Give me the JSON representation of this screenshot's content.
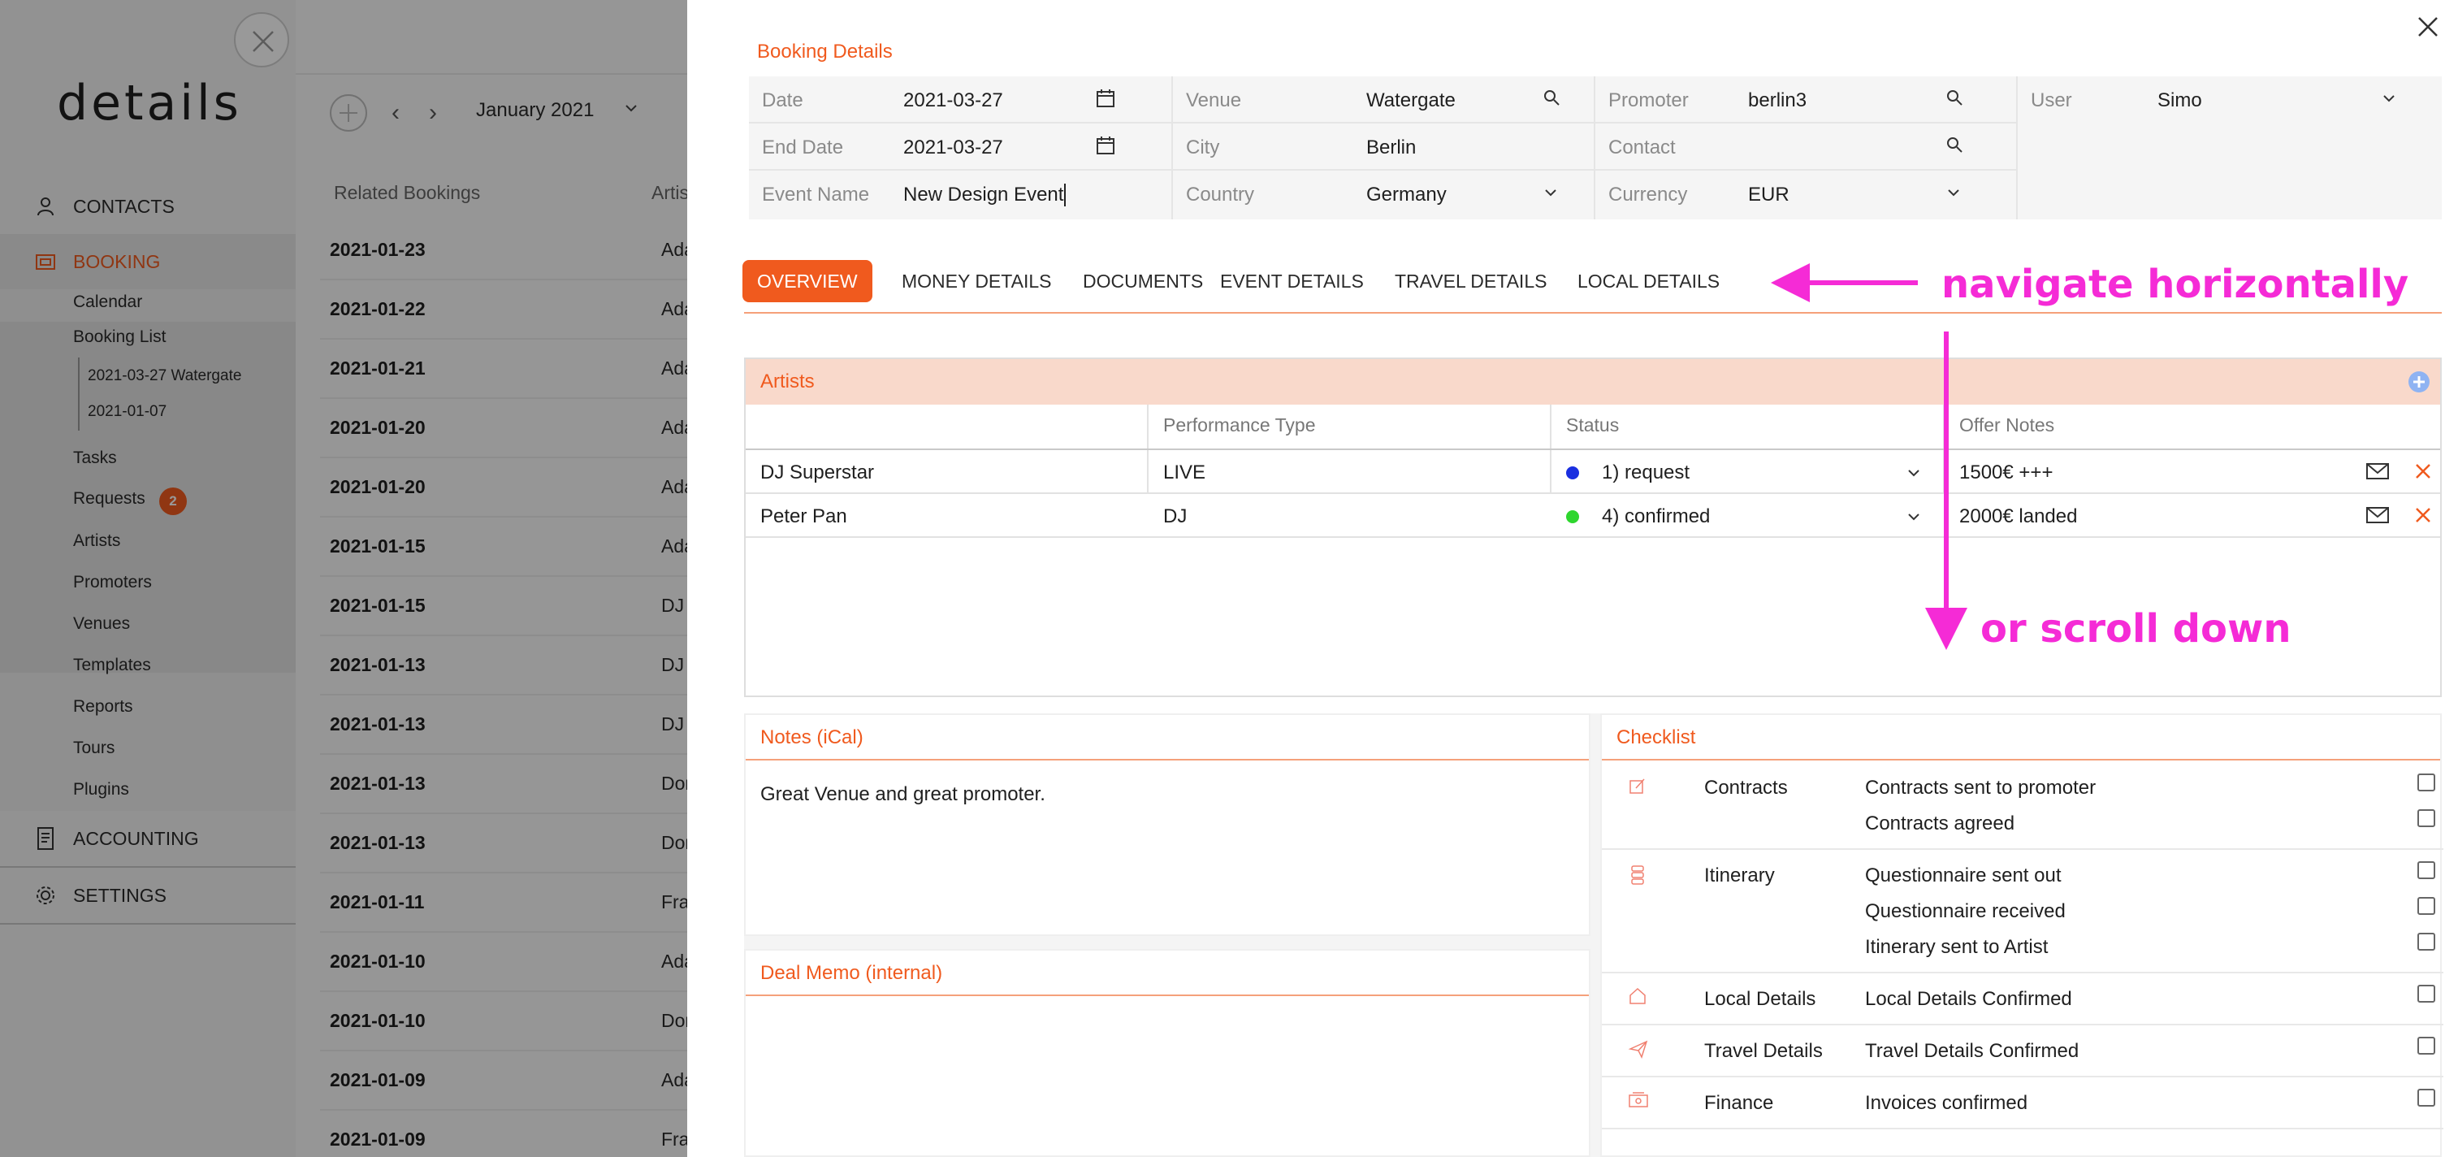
{
  "sidebar": {
    "logo": "details",
    "nav": {
      "contacts": "CONTACTS",
      "booking": "BOOKING",
      "accounting": "ACCOUNTING",
      "settings": "SETTINGS"
    },
    "booking_items": {
      "calendar": "Calendar",
      "booking_list": "Booking List",
      "sub1": "2021-03-27 Watergate",
      "sub2": "2021-01-07",
      "tasks": "Tasks",
      "requests": "Requests",
      "requests_badge": "2",
      "artists": "Artists",
      "promoters": "Promoters",
      "venues": "Venues",
      "templates": "Templates",
      "reports": "Reports",
      "tours": "Tours",
      "plugins": "Plugins"
    },
    "accent_color": "#f05a1e"
  },
  "list": {
    "month": "January 2021",
    "col_related": "Related Bookings",
    "col_artist": "Artist",
    "rows": [
      {
        "date": "2021-01-23",
        "artist": "Adam"
      },
      {
        "date": "2021-01-22",
        "artist": "Adam"
      },
      {
        "date": "2021-01-21",
        "artist": "Adam"
      },
      {
        "date": "2021-01-20",
        "artist": "Adam"
      },
      {
        "date": "2021-01-20",
        "artist": "Adam"
      },
      {
        "date": "2021-01-15",
        "artist": "Adam"
      },
      {
        "date": "2021-01-15",
        "artist": "DJ S"
      },
      {
        "date": "2021-01-13",
        "artist": "DJ S"
      },
      {
        "date": "2021-01-13",
        "artist": "DJ S"
      },
      {
        "date": "2021-01-13",
        "artist": "Don"
      },
      {
        "date": "2021-01-13",
        "artist": "Don"
      },
      {
        "date": "2021-01-11",
        "artist": "Fran"
      },
      {
        "date": "2021-01-10",
        "artist": "Adam"
      },
      {
        "date": "2021-01-10",
        "artist": "Don"
      },
      {
        "date": "2021-01-09",
        "artist": "Adam"
      },
      {
        "date": "2021-01-09",
        "artist": "Fran"
      }
    ]
  },
  "booking": {
    "title": "Booking Details",
    "fields": {
      "date_label": "Date",
      "date_value": "2021-03-27",
      "end_date_label": "End Date",
      "end_date_value": "2021-03-27",
      "event_name_label": "Event Name",
      "event_name_value": "New Design Event",
      "venue_label": "Venue",
      "venue_value": "Watergate",
      "city_label": "City",
      "city_value": "Berlin",
      "country_label": "Country",
      "country_value": "Germany",
      "promoter_label": "Promoter",
      "promoter_value": "berlin3",
      "contact_label": "Contact",
      "contact_value": "",
      "currency_label": "Currency",
      "currency_value": "EUR",
      "user_label": "User",
      "user_value": "Simo"
    },
    "tabs": [
      "OVERVIEW",
      "MONEY DETAILS",
      "DOCUMENTS",
      "EVENT DETAILS",
      "TRAVEL DETAILS",
      "LOCAL DETAILS"
    ],
    "active_tab": "OVERVIEW"
  },
  "artists_table": {
    "title": "Artists",
    "headers": [
      "",
      "Performance Type",
      "Status",
      "Offer Notes"
    ],
    "rows": [
      {
        "name": "DJ Superstar",
        "type": "LIVE",
        "status": "1) request",
        "status_color": "#1a2fe0",
        "notes": "1500€ +++"
      },
      {
        "name": "Peter Pan",
        "type": "DJ",
        "status": "4) confirmed",
        "status_color": "#2ed62e",
        "notes": "2000€ landed"
      }
    ]
  },
  "notes": {
    "title": "Notes (iCal)",
    "text": "Great Venue and great promoter."
  },
  "deal_memo": {
    "title": "Deal Memo (internal)",
    "text": ""
  },
  "checklist": {
    "title": "Checklist",
    "groups": [
      {
        "category": "Contracts",
        "icon": "edit-icon",
        "items": [
          "Contracts sent to promoter",
          "Contracts agreed"
        ]
      },
      {
        "category": "Itinerary",
        "icon": "itinerary-icon",
        "items": [
          "Questionnaire sent out",
          "Questionnaire received",
          "Itinerary sent to Artist"
        ]
      },
      {
        "category": "Local Details",
        "icon": "home-icon",
        "items": [
          "Local Details Confirmed"
        ]
      },
      {
        "category": "Travel Details",
        "icon": "plane-icon",
        "items": [
          "Travel Details Confirmed"
        ]
      },
      {
        "category": "Finance",
        "icon": "finance-icon",
        "items": [
          "Invoices confirmed"
        ]
      }
    ]
  },
  "annotations": {
    "horizontal": "navigate horizontally",
    "vertical": "or scroll down",
    "color": "#f52bd6"
  }
}
